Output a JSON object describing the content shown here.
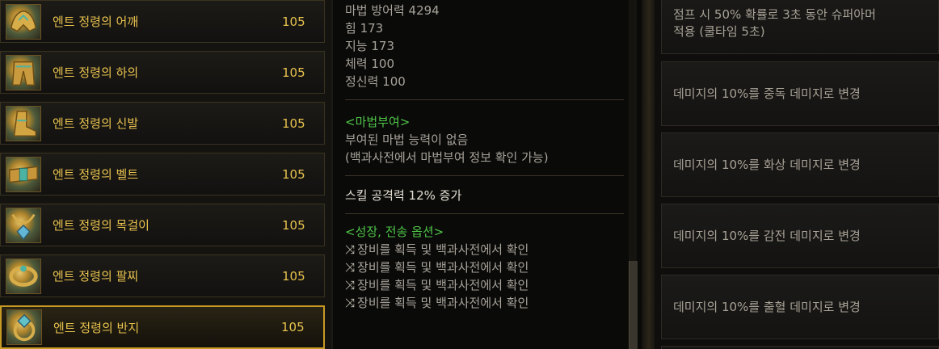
{
  "equipment_list": [
    {
      "name": "엔트 정령의 어깨",
      "level": "105",
      "icon": "shoulder-armor-icon",
      "selected": false
    },
    {
      "name": "엔트 정령의 하의",
      "level": "105",
      "icon": "pants-armor-icon",
      "selected": false
    },
    {
      "name": "엔트 정령의 신발",
      "level": "105",
      "icon": "boots-armor-icon",
      "selected": false
    },
    {
      "name": "엔트 정령의 벨트",
      "level": "105",
      "icon": "belt-armor-icon",
      "selected": false
    },
    {
      "name": "엔트 정령의 목걸이",
      "level": "105",
      "icon": "necklace-icon",
      "selected": false
    },
    {
      "name": "엔트 정령의 팔찌",
      "level": "105",
      "icon": "bracelet-icon",
      "selected": false
    },
    {
      "name": "엔트 정령의 반지",
      "level": "105",
      "icon": "ring-icon",
      "selected": true
    }
  ],
  "details": {
    "stats": [
      "마법 방어력 4294",
      "힘 173",
      "지능 173",
      "체력 100",
      "정신력 100"
    ],
    "enchant_header": "<마법부여>",
    "enchant_lines": [
      "부여된 마법 능력이 없음",
      "(백과사전에서 마법부여 정보 확인 가능)"
    ],
    "skill_line": "스킬 공격력 12% 증가",
    "growth_header": "<성장, 전송 옵션>",
    "growth_icon": "shuffle-icon",
    "growth_lines": [
      "장비를 획득 및 백과사전에서 확인",
      "장비를 획득 및 백과사전에서 확인",
      "장비를 획득 및 백과사전에서 확인",
      "장비를 획득 및 백과사전에서 확인"
    ]
  },
  "options": [
    {
      "lines": [
        "점프 시 50% 확률로 3초 동안 슈퍼아머",
        "적용 (쿨타임 5초)"
      ]
    },
    {
      "lines": [
        "데미지의 10%를 중독 데미지로 변경"
      ]
    },
    {
      "lines": [
        "데미지의 10%를 화상 데미지로 변경"
      ]
    },
    {
      "lines": [
        "데미지의 10%를 감전 데미지로 변경"
      ]
    },
    {
      "lines": [
        "데미지의 10%를 출혈 데미지로 변경"
      ]
    }
  ],
  "colors": {
    "item_name": "#e8c24e",
    "highlight_border": "#c79a24",
    "header_green": "#4fc447"
  }
}
